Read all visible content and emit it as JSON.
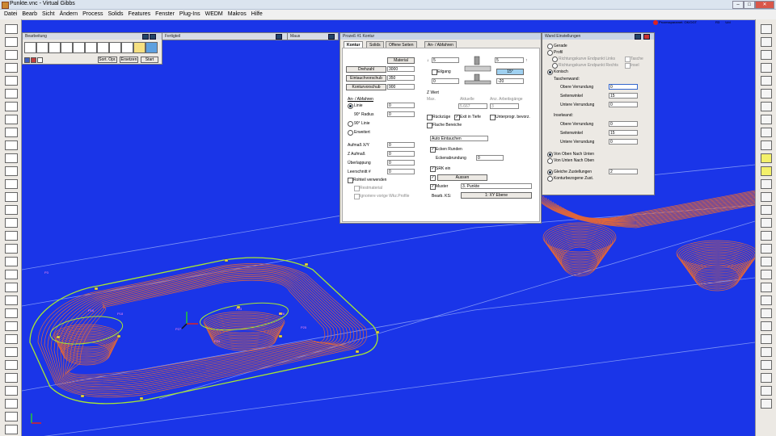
{
  "window": {
    "title": "Punkte.vnc - Virtual Gibbs",
    "min": "–",
    "max": "□",
    "close": "✕"
  },
  "menu": [
    "Datei",
    "Bearb",
    "Sicht",
    "Ändern",
    "Process",
    "Solids",
    "Features",
    "Fenster",
    "Plug-Ins",
    "WEDM",
    "Makros",
    "Hilfe"
  ],
  "status_right": {
    "text": "Prozessparamet. OK/OGT",
    "r1": "R3",
    "r2": "R40",
    "r3": "U/d",
    "r4": "AG1"
  },
  "panels": {
    "bearbeitung": {
      "title": "Bearbeitung",
      "b1": "Sort. Opr.",
      "b2": "Ersetzen",
      "b3": "Start"
    },
    "fertigteil": {
      "title": "Fertigteil"
    },
    "maus": {
      "title": "Maus"
    }
  },
  "prozess": {
    "title": "Prozeß #1 Kontur",
    "tabs": [
      "Kontur",
      "Solids",
      "Offene Seiten",
      "An- / Abfahren"
    ],
    "material_btn": "Material",
    "drehzahl_btn": "Drehzahl",
    "drehzahl": "3000",
    "eintauch_btn": "Eintauchvorschub",
    "eintauch": "350",
    "kontur_btn": "Konturvorschub",
    "kontur": "900",
    "depth_top": "5",
    "depth_right": "5",
    "eilgang": "Eilgang",
    "val_left0": "0",
    "angle_btn": "15°",
    "val_right": "-20",
    "anab_label": "An- / Abfahren",
    "linie": "Linie",
    "linie_v": "0",
    "radius90": "90° Radius",
    "radius90_v": "0",
    "linie90": "90° Linie",
    "erweitert": "Erweitert",
    "zwert": "Z Wert",
    "max": "Max.",
    "aktuelle": "Aktuelle",
    "anz": "Anz. Arbeitsgänge",
    "aktuelle_v": "5.667",
    "anz_v": "3",
    "rueckzuege": "Rückzüge",
    "exit_tiefe": "Exit in Tiefe",
    "unterprog": "Unterprogr. bevorz.",
    "flache": "Flache Bereiche",
    "aufmass": "Aufmaß X/Y",
    "aufmass_v": "0",
    "zaufmass": "Z Aufmaß",
    "zaufmass_v": "0",
    "ueberlappung": "Überlappung",
    "ueberlappung_v": "0",
    "leerschnitt": "Leerschnitt #",
    "leerschnitt_v": "0",
    "rohteil": "Rohteil verwenden",
    "restmaterial": "Restmaterial",
    "ignoriere": "Ignoriere vorige Wkz.Profile",
    "auto_eintauchen": "Auto Eintauchen",
    "ecken_runden": "Ecken Runden",
    "eckenrundung": "Eckenabrundung",
    "eckenrundung_v": "0",
    "srk_ein": "SRK ein",
    "aussen": "Aussen",
    "muster": "Muster",
    "muster_v": "3. Punkte",
    "beab_ks": "Bearb. KS:",
    "xy_ebene": "1: XY Ebene"
  },
  "wand": {
    "title": "Wand Einstellungen",
    "gerade": "Gerade",
    "profil": "Profil",
    "rk_links": "Richtungskurve Endpunkt Links",
    "tasche": "Tasche",
    "rk_rechts": "Richtungskurve Endpunkt Rechts",
    "insel": "Insel",
    "konisch": "Konisch",
    "taschenwand": "Taschenwand:",
    "obere": "Obere Verrundung",
    "obere_v": "0",
    "seitenwinkel": "Seitenwinkel",
    "seitenwinkel_v": "15",
    "untere": "Untere Verrundung",
    "untere_v": "0",
    "inselwand": "Inselwand:",
    "obere2_v": "0",
    "seitenwinkel2_v": "15",
    "untere2_v": "0",
    "oben_unten": "Von Oben Nach Unten",
    "unten_oben": "Von Unten Nach Oben",
    "gleiche": "Gleiche Zustellungen",
    "gleiche_v": "2",
    "konturbezogene": "Konturbezogene Zust."
  },
  "viewport": {
    "labels": [
      "P3",
      "P16",
      "P18",
      "P23",
      "P26",
      "P25",
      "P24",
      "P27"
    ],
    "colors": {
      "bg": "#1a35e8",
      "toolpath": "#e0663a",
      "contour": "#a8e830",
      "guide": "#7d93f5"
    }
  }
}
